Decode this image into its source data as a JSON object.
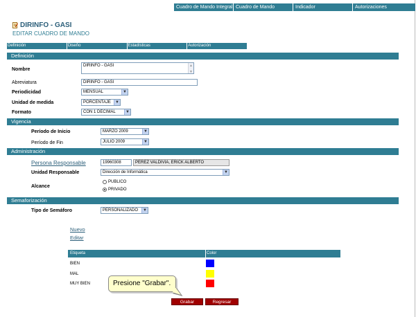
{
  "top_nav": [
    "Cuadro de Mando Integral",
    "Cuadro de Mando",
    "Indicador",
    "Autorizaciones"
  ],
  "header": {
    "title": "DIRINFO - GASI",
    "subtitle": "EDITAR CUADRO DE MANDO"
  },
  "tabs": [
    "Definición",
    "Diseño",
    "Estadísticas",
    "Autorización"
  ],
  "definicion": {
    "section": "Definición",
    "nombre_label": "Nombre",
    "nombre_value": "DIRINFO - GASI",
    "abreviatura_label": "Abreviatura",
    "abreviatura_value": "DIRINFO - GASI",
    "periodicidad_label": "Periodicidad",
    "periodicidad_value": "MENSUAL",
    "unidad_label": "Unidad de medida",
    "unidad_value": "PORCENTAJE",
    "formato_label": "Formato",
    "formato_value": "CON 1 DECIMAL"
  },
  "vigencia": {
    "section": "Vigencia",
    "inicio_label": "Período de Inicio",
    "inicio_value": "MARZO 2009",
    "fin_label": "Período de Fin",
    "fin_value": "JULIO 2009"
  },
  "administracion": {
    "section": "Administración",
    "responsable_label": "Persona Responsable",
    "responsable_code": "19960308",
    "responsable_name": "PÉREZ VALDIVIA, ERICK ALBERTO",
    "unidad_resp_label": "Unidad Responsable",
    "unidad_resp_value": "Dirección de Informática",
    "alcance_label": "Alcance",
    "opt_publico": "PUBLICO",
    "opt_privado": "PRIVADO"
  },
  "semaforizacion": {
    "section": "Semaforización",
    "tipo_label": "Tipo de Semáforo",
    "tipo_value": "PERSONALIZADO",
    "nuevo": "Nuevo",
    "editar": "Editar",
    "col_etiqueta": "Etiqueta",
    "col_color": "Color",
    "rows": [
      {
        "label": "BIEN",
        "color": "#0000ff"
      },
      {
        "label": "MAL",
        "color": "#ffff00"
      },
      {
        "label": "MUY BIEN",
        "color": "#ff0000"
      }
    ]
  },
  "buttons": {
    "grabar": "Grabar",
    "regresar": "Regresar"
  },
  "callout": "Presione \"Grabar\"."
}
